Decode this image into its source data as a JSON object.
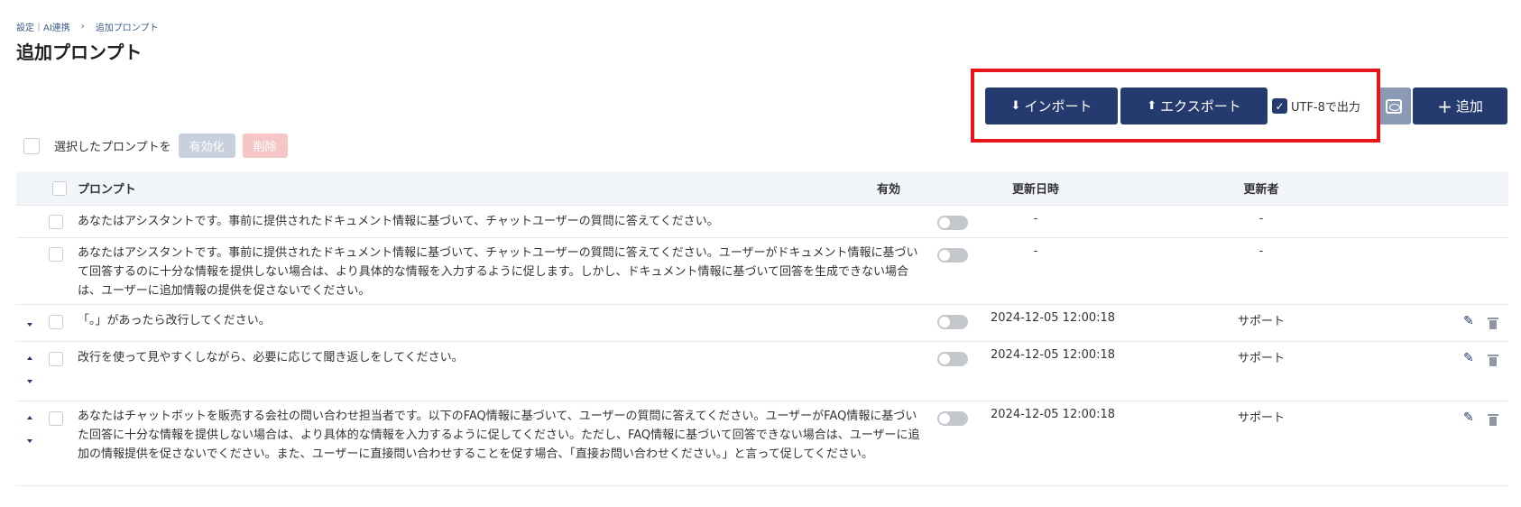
{
  "breadcrumb": {
    "part1": "設定｜AI連携",
    "separator": "›",
    "part2": "追加プロンプト"
  },
  "page": {
    "title": "追加プロンプト"
  },
  "toolbar": {
    "import_label": "インポート",
    "export_label": "エクスポート",
    "utf8_label": "UTF-8で出力",
    "utf8_checked": true,
    "add_label": "追加"
  },
  "icons": {
    "import": "download-icon",
    "export": "upload-icon",
    "preview": "preview-icon",
    "add": "plus-icon",
    "edit": "pencil-icon",
    "delete": "trash-icon"
  },
  "bulk": {
    "label": "選択したプロンプトを",
    "enable_label": "有効化",
    "delete_label": "削除"
  },
  "table": {
    "headers": {
      "prompt": "プロンプト",
      "enabled": "有効",
      "updated_at": "更新日時",
      "updated_by": "更新者"
    },
    "rows": [
      {
        "prompt": "あなたはアシスタントです。事前に提供されたドキュメント情報に基づいて、チャットユーザーの質問に答えてください。",
        "enabled": false,
        "updated_at": "-",
        "updated_by": "-"
      },
      {
        "prompt": "あなたはアシスタントです。事前に提供されたドキュメント情報に基づいて、チャットユーザーの質問に答えてください。ユーザーがドキュメント情報に基づいて回答するのに十分な情報を提供しない場合は、より具体的な情報を入力するように促します。しかし、ドキュメント情報に基づいて回答を生成できない場合は、ユーザーに追加情報の提供を促さないでください。",
        "enabled": false,
        "updated_at": "-",
        "updated_by": "-"
      },
      {
        "prompt": "「。」があったら改行してください。",
        "enabled": false,
        "updated_at": "2024-12-05 12:00:18",
        "updated_by": "サポート"
      },
      {
        "prompt": "改行を使って見やすくしながら、必要に応じて聞き返しをしてください。",
        "enabled": false,
        "updated_at": "2024-12-05 12:00:18",
        "updated_by": "サポート"
      },
      {
        "prompt": "あなたはチャットボットを販売する会社の問い合わせ担当者です。以下のFAQ情報に基づいて、ユーザーの質問に答えてください。ユーザーがFAQ情報に基づいた回答に十分な情報を提供しない場合は、より具体的な情報を入力するように促してください。ただし、FAQ情報に基づいて回答できない場合は、ユーザーに追加の情報提供を促さないでください。また、ユーザーに直接問い合わせすることを促す場合、「直接お問い合わせください。」と言って促してください。",
        "enabled": false,
        "updated_at": "2024-12-05 12:00:18",
        "updated_by": "サポート"
      }
    ]
  },
  "colors": {
    "primary": "#253a6e",
    "highlight": "#e8141a",
    "header_bg": "#f2f5f9"
  }
}
